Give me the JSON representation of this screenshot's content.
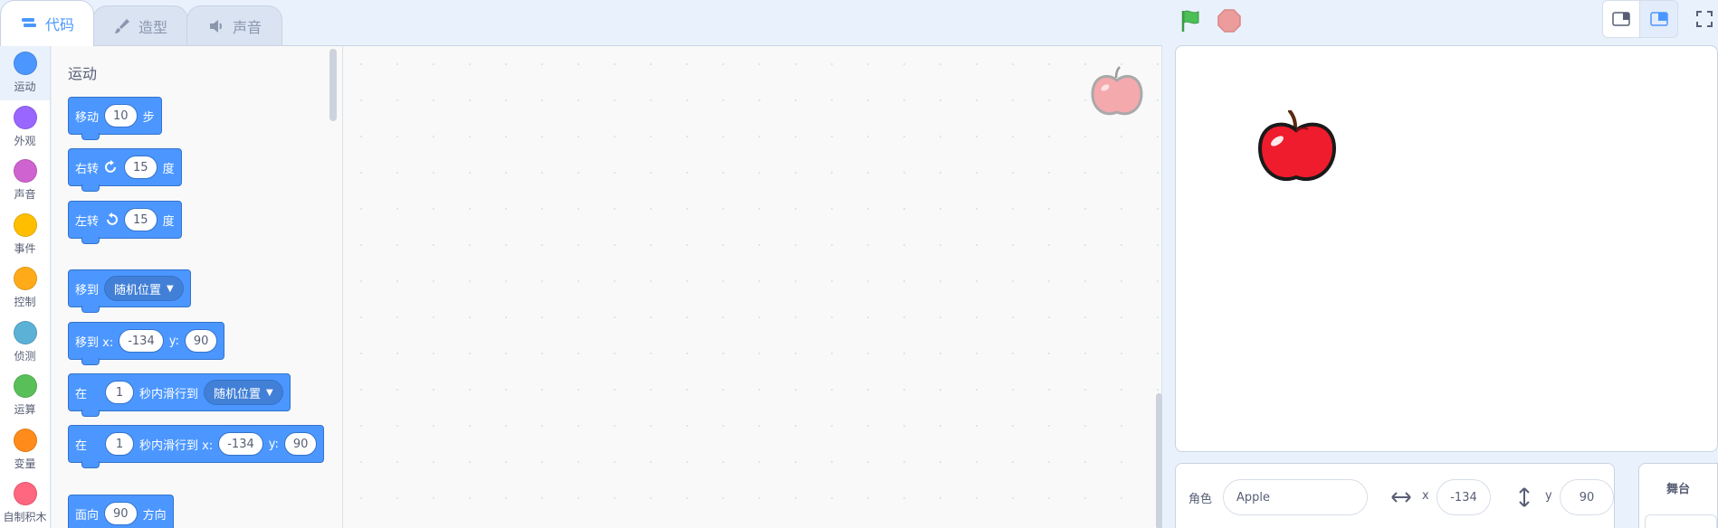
{
  "tabs": [
    {
      "label": "代码",
      "icon": "code-icon"
    },
    {
      "label": "造型",
      "icon": "brush-icon"
    },
    {
      "label": "声音",
      "icon": "speaker-icon"
    }
  ],
  "categories": [
    {
      "label": "运动",
      "color": "#4c97ff"
    },
    {
      "label": "外观",
      "color": "#9966ff"
    },
    {
      "label": "声音",
      "color": "#cf63cf"
    },
    {
      "label": "事件",
      "color": "#ffbf00"
    },
    {
      "label": "控制",
      "color": "#ffab19"
    },
    {
      "label": "侦测",
      "color": "#5cb1d6"
    },
    {
      "label": "运算",
      "color": "#59c059"
    },
    {
      "label": "变量",
      "color": "#ff8c1a"
    },
    {
      "label": "自制积木",
      "color": "#ff6680"
    }
  ],
  "palette": {
    "title": "运动",
    "move": {
      "label": "移动",
      "value": "10",
      "suffix": "步"
    },
    "turn_right": {
      "label": "右转",
      "value": "15",
      "suffix": "度"
    },
    "turn_left": {
      "label": "左转",
      "value": "15",
      "suffix": "度"
    },
    "goto": {
      "label": "移到",
      "option": "随机位置"
    },
    "goto_xy": {
      "label": "移到 x:",
      "x": "-134",
      "ylabel": "y:",
      "y": "90"
    },
    "glide": {
      "label": "在",
      "secs": "1",
      "mid": "秒内滑行到",
      "option": "随机位置"
    },
    "glide_xy": {
      "label": "在",
      "secs": "1",
      "mid": "秒内滑行到 x:",
      "x": "-134",
      "ylabel": "y:",
      "y": "90"
    },
    "point": {
      "label": "面向",
      "value": "90",
      "suffix": "方向"
    }
  },
  "sprite": {
    "label": "角色",
    "name": "Apple",
    "x_label": "x",
    "x": "-134",
    "y_label": "y",
    "y": "90"
  },
  "stage_panel": {
    "label": "舞台"
  },
  "colors": {
    "accent": "#4c97ff",
    "flag": "#4cbf56",
    "stop": "#ec9c9c"
  }
}
